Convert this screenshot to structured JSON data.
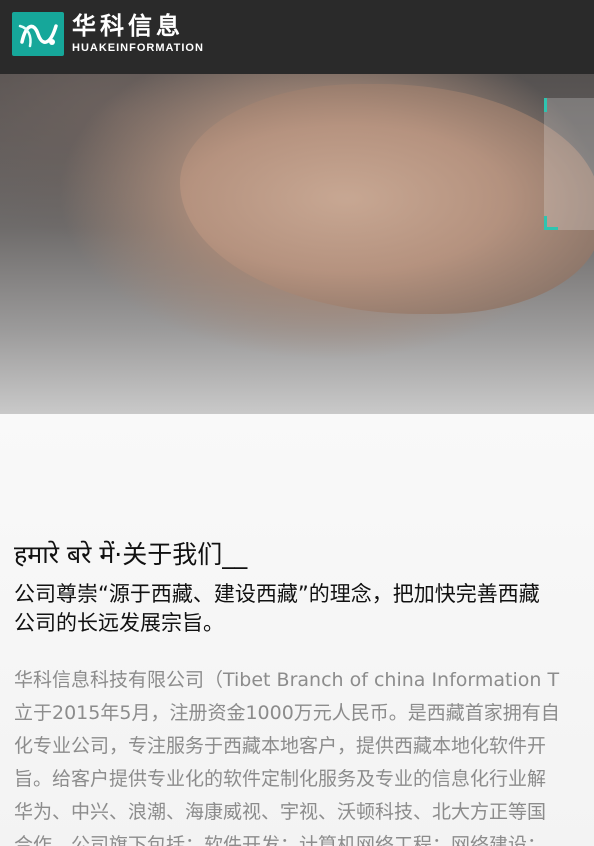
{
  "header": {
    "logo_cn": "华科信息",
    "logo_en": "HUAKEINFORMATION",
    "logo_icon": "hk-logo-mark"
  },
  "colors": {
    "header_bg": "#2a2a2a",
    "logo_accent": "#16a79a",
    "bracket_accent": "#2ec4b0"
  },
  "about": {
    "title": "हमारे बरे में·关于我们__",
    "lead_lines": [
      "公司尊崇“源于西藏、建设西藏”的理念，把加快完善西藏",
      "公司的长远发展宗旨。"
    ],
    "body_lines": [
      "华科信息科技有限公司（Tibet Branch of china Information T",
      "立于2015年5月，注册资金1000万元人民币。是西藏首家拥有自",
      "化专业公司，专注服务于西藏本地客户，提供西藏本地化软件开",
      "旨。给客户提供专业化的软件定制化服务及专业的信息化行业解",
      "华为、中兴、浪潮、海康威视、宇视、沃顿科技、北大方正等国",
      "合作，公司旗下包括：软件开发；计算机网络工程；网络建设；"
    ]
  }
}
